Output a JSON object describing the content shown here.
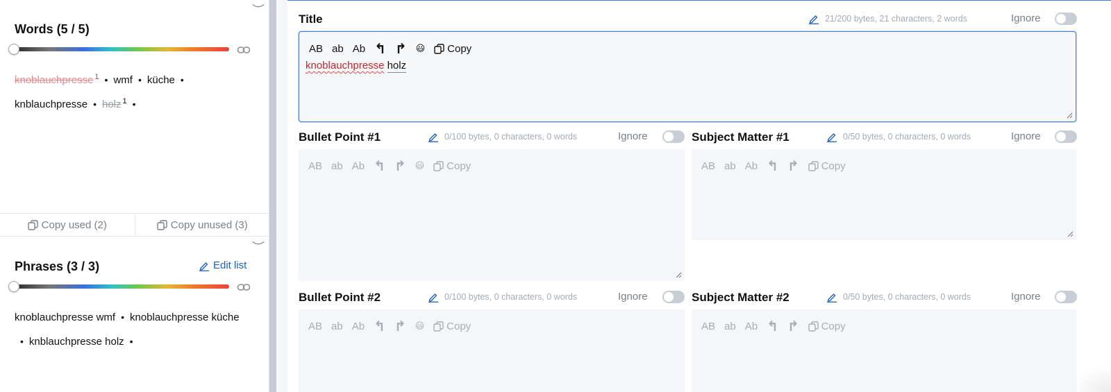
{
  "words_panel": {
    "title": "Words (5 / 5)",
    "items": [
      {
        "text": "knoblauchpresse",
        "style": "struck",
        "sup": "1"
      },
      {
        "text": "wmf",
        "style": "normal",
        "sup": ""
      },
      {
        "text": "küche",
        "style": "normal",
        "sup": ""
      },
      {
        "text": "knblauchpresse",
        "style": "normal",
        "sup": ""
      },
      {
        "text": "holz",
        "style": "struck-grey",
        "sup": "1"
      }
    ],
    "copy_used": "Copy used (2)",
    "copy_unused": "Copy unused (3)"
  },
  "phrases_panel": {
    "title": "Phrases (3 / 3)",
    "edit_label": "Edit list",
    "items": [
      "knoblauchpresse wmf",
      "knoblauchpresse küche",
      "knblauchpresse holz"
    ]
  },
  "toolbar": {
    "upper": "AB",
    "lower": "ab",
    "capital": "Ab",
    "undo": "↰",
    "redo": "↱",
    "emoji": "😃",
    "copy": "Copy"
  },
  "fields": {
    "title": {
      "label": "Title",
      "meta": "21/200 bytes, 21 characters, 2 words",
      "ignore": "Ignore",
      "value_misspelled": "knoblauchpresse",
      "value_rest": "holz"
    },
    "bullet1": {
      "label": "Bullet Point #1",
      "meta": "0/100 bytes, 0 characters, 0 words",
      "ignore": "Ignore"
    },
    "subject1": {
      "label": "Subject Matter #1",
      "meta": "0/50 bytes, 0 characters, 0 words",
      "ignore": "Ignore"
    },
    "bullet2": {
      "label": "Bullet Point #2",
      "meta": "0/100 bytes, 0 characters, 0 words",
      "ignore": "Ignore"
    },
    "subject2": {
      "label": "Subject Matter #2",
      "meta": "0/50 bytes, 0 characters, 0 words",
      "ignore": "Ignore"
    }
  },
  "colors": {
    "accent": "#1f5fbf",
    "focus_border": "#4a7fd6",
    "misspelled": "#c0282f"
  }
}
